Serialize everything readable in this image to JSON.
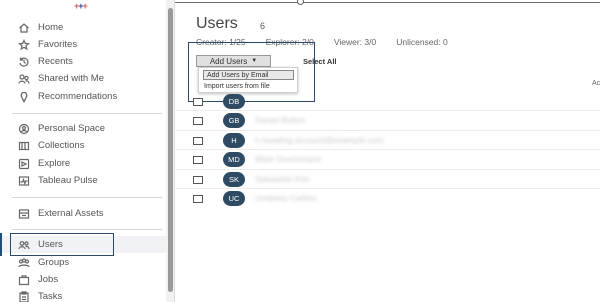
{
  "sidebar": {
    "items": [
      {
        "label": "Home",
        "icon": "home-icon"
      },
      {
        "label": "Favorites",
        "icon": "star-icon"
      },
      {
        "label": "Recents",
        "icon": "history-icon"
      },
      {
        "label": "Shared with Me",
        "icon": "shared-icon"
      },
      {
        "label": "Recommendations",
        "icon": "lightbulb-icon"
      },
      {
        "label": "Personal Space",
        "icon": "personal-space-icon"
      },
      {
        "label": "Collections",
        "icon": "collections-icon"
      },
      {
        "label": "Explore",
        "icon": "explore-icon"
      },
      {
        "label": "Tableau Pulse",
        "icon": "pulse-icon"
      },
      {
        "label": "External Assets",
        "icon": "external-assets-icon"
      },
      {
        "label": "Users",
        "icon": "users-icon"
      },
      {
        "label": "Groups",
        "icon": "groups-icon"
      },
      {
        "label": "Jobs",
        "icon": "jobs-icon"
      },
      {
        "label": "Tasks",
        "icon": "tasks-icon"
      }
    ]
  },
  "main": {
    "title": "Users",
    "count": "6",
    "stats": [
      "Creator: 1/25",
      "Explorer: 2/0",
      "Viewer: 3/0",
      "Unlicensed: 0"
    ],
    "add_users_label": "Add Users",
    "select_all_label": "Select All",
    "menu": [
      "Add Users by Email",
      "Import users from file"
    ],
    "header_right": "Ac",
    "users": [
      {
        "initials": "DB",
        "name": ""
      },
      {
        "initials": "GB",
        "name": "Daniel Bolton"
      },
      {
        "initials": "H",
        "name": "h.heading.account@example.com"
      },
      {
        "initials": "MD",
        "name": "Mark Deschmann"
      },
      {
        "initials": "SK",
        "name": "Sebastian Kim"
      },
      {
        "initials": "UC",
        "name": "Umberto Carlino"
      }
    ]
  }
}
